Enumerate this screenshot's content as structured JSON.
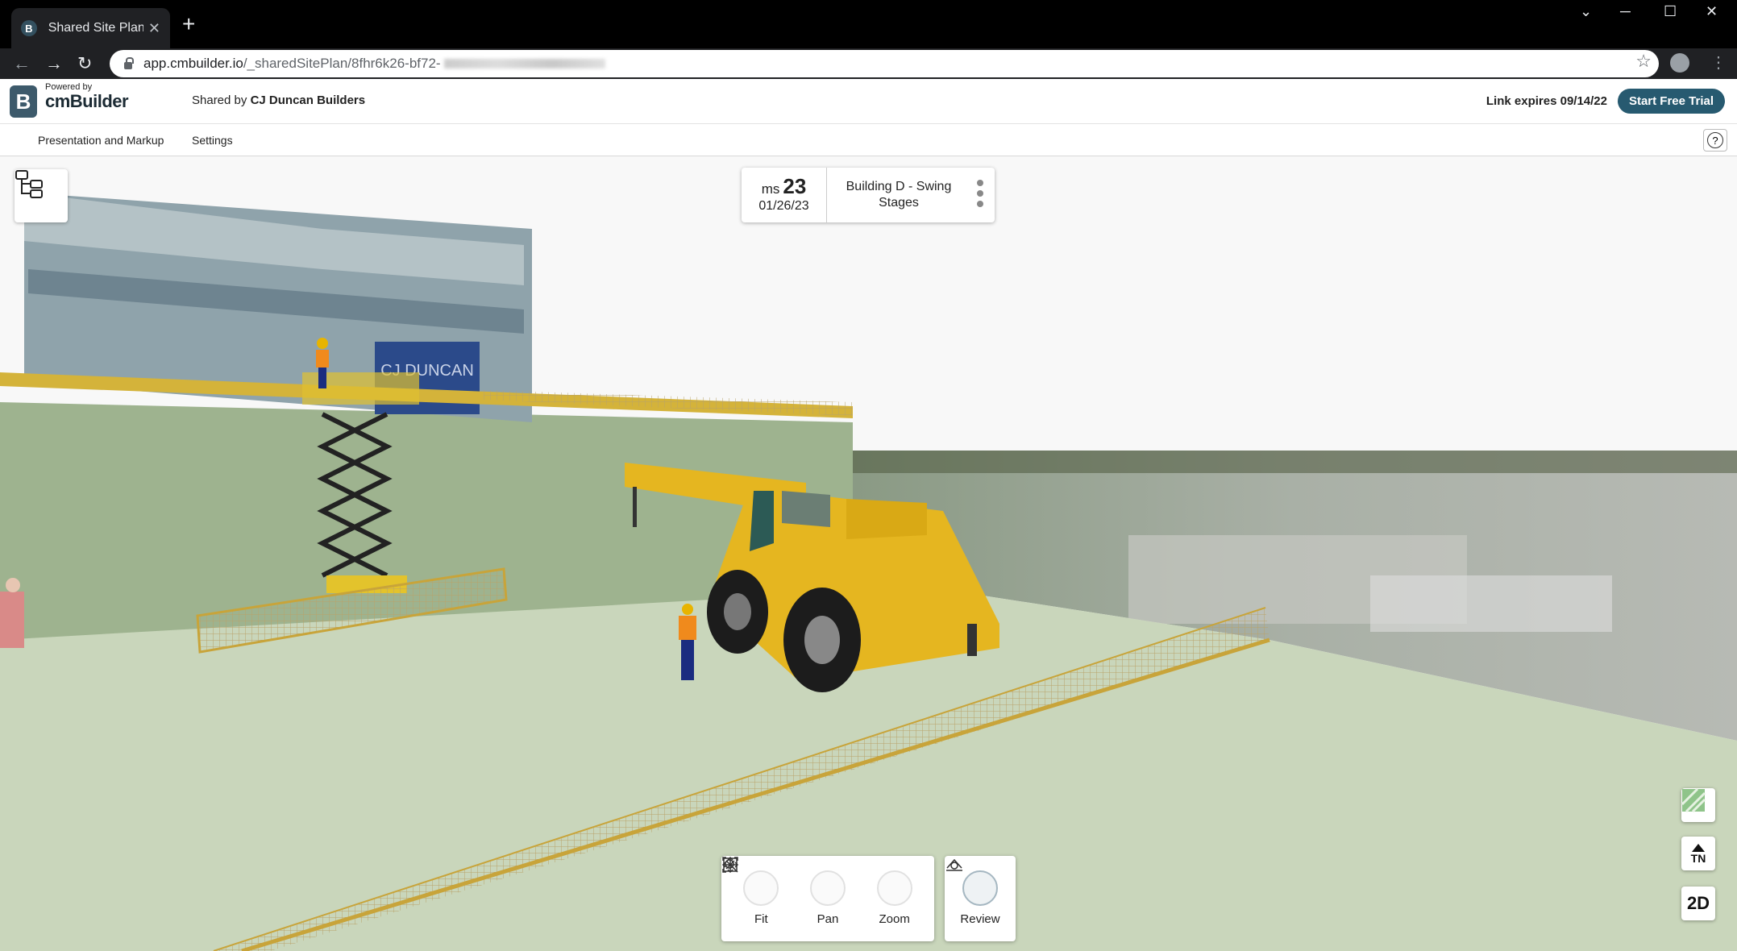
{
  "browser": {
    "tab_title": "Shared Site Plans -",
    "tab_favicon_letter": "B",
    "url_host": "app.cmbuilder.io",
    "url_path": "/_sharedSitePlan/8fhr6k26-bf72-"
  },
  "header": {
    "powered_by": "Powered by",
    "brand": "cmBuilder",
    "logo_letter": "B",
    "shared_by_prefix": "Shared by",
    "shared_by_company": "CJ Duncan Builders",
    "link_expires": "Link expires 09/14/22",
    "trial_button": "Start Free Trial"
  },
  "menu": {
    "items": [
      {
        "label": "Presentation and Markup"
      },
      {
        "label": "Settings"
      }
    ],
    "help_label": "?"
  },
  "milestone": {
    "prefix": "ms",
    "number": "23",
    "date": "01/26/23",
    "title": "Building D - Swing Stages"
  },
  "toolbar": {
    "tools": [
      {
        "label": "Fit",
        "icon": "fit-icon"
      },
      {
        "label": "Pan",
        "icon": "pan-icon"
      },
      {
        "label": "Zoom",
        "icon": "zoom-icon"
      }
    ],
    "review": {
      "label": "Review",
      "icon": "review-icon"
    }
  },
  "side_controls": {
    "basemap_icon": "satellite-map-icon",
    "north_label": "TN",
    "view_mode": "2D"
  },
  "scene": {
    "building_sign": "CJ DUNCAN",
    "colors": {
      "sky": "#f8f8f8",
      "ground": "#c9d6bb",
      "wall": "#9eb38f",
      "crane": "#e5b620",
      "fence": "#c8a43a",
      "brand_button": "#275a70"
    }
  }
}
